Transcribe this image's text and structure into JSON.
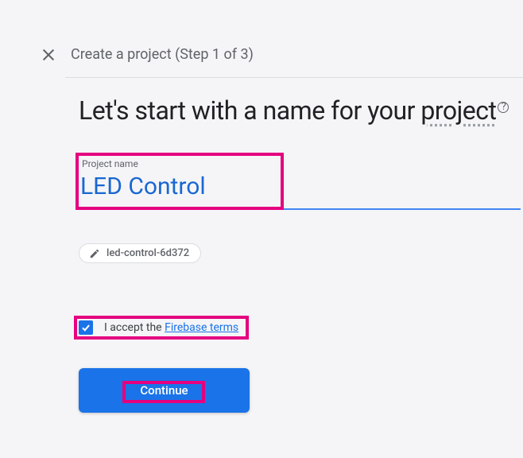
{
  "header": {
    "title": "Create a project (Step 1 of 3)"
  },
  "heading": {
    "part1": "Let's start with a name for your ",
    "part2": "project"
  },
  "input": {
    "label": "Project name",
    "value": "LED Control"
  },
  "chip": {
    "id": "led-control-6d372"
  },
  "terms": {
    "prefix": "I accept the ",
    "link_text": "Firebase terms",
    "checked": true
  },
  "button": {
    "continue_label": "Continue"
  }
}
